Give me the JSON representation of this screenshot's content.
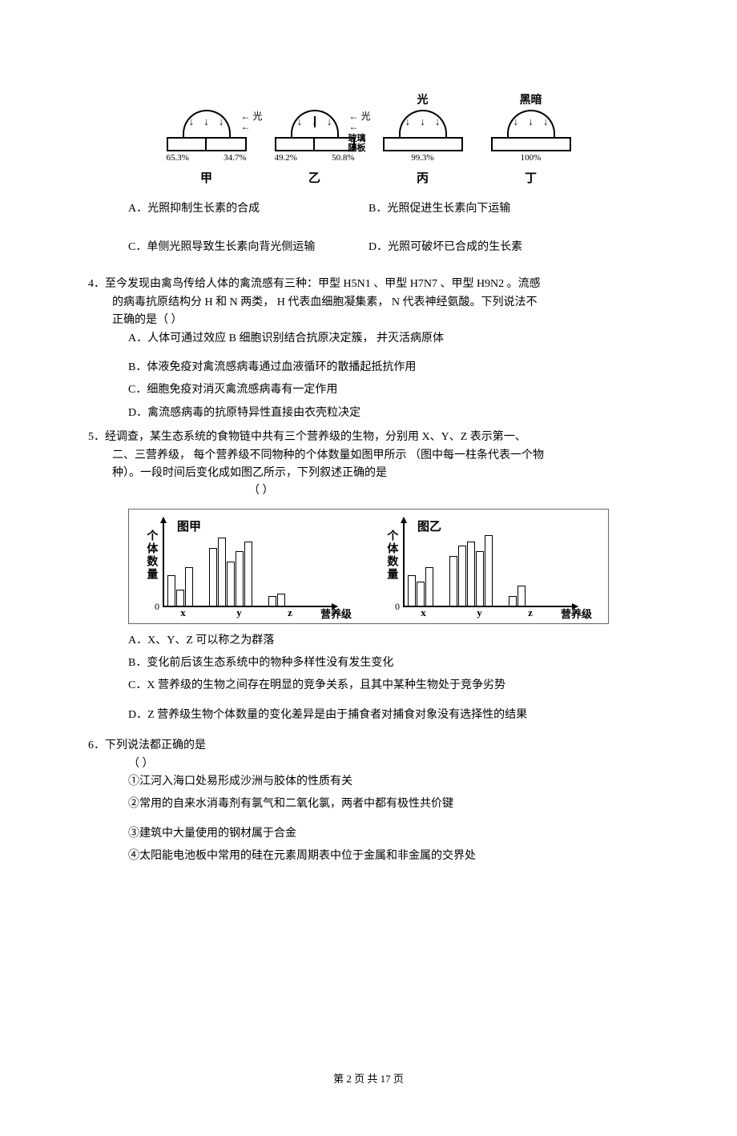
{
  "diagram_top": {
    "items": [
      {
        "top_label": "",
        "light_side": true,
        "glass": false,
        "left_pct": "65.3%",
        "right_pct": "34.7%",
        "name": "甲"
      },
      {
        "top_label": "",
        "light_side": true,
        "glass": true,
        "left_pct": "49.2%",
        "right_pct": "50.8%",
        "name": "乙"
      },
      {
        "top_label": "光",
        "light_side": false,
        "glass": false,
        "center_pct": "99.3%",
        "name": "丙"
      },
      {
        "top_label": "黑暗",
        "light_side": false,
        "glass": false,
        "center_pct": "100%",
        "name": "丁"
      }
    ],
    "light_label": "光",
    "glass_label_l1": "玻璃",
    "glass_label_l2": "隔板"
  },
  "q3_options": {
    "A": "A．光照抑制生长素的合成",
    "B": "B．光照促进生长素向下运输",
    "C": "C．单侧光照导致生长素向背光侧运输",
    "D": "D．光照可破坏已合成的生长素"
  },
  "q4": {
    "stem_l1": "4．至今发现由禽鸟传给人体的禽流感有三种：甲型    H5N1 、甲型 H7N7 、甲型 H9N2 。流感",
    "stem_l2": "的病毒抗原结构分   H 和 N 两类，  H 代表血细胞凝集素，   N 代表神经氨酸。下列说法不",
    "stem_l3": "正确的是（     ）",
    "A": "A．人体可通过效应   B 细胞识别结合抗原决定簇，   并灭活病原体",
    "B": "B．体液免疫对禽流感病毒通过血液循环的散播起抵抗作用",
    "C": "C．细胞免疫对消灭禽流感病毒有一定作用",
    "D": "D．禽流感病毒的抗原特异性直接由衣壳粒决定"
  },
  "q5": {
    "stem_l1": "5．经调查，某生态系统的食物链中共有三个营养级的生物，分别用        X、Y、Z 表示第一、",
    "stem_l2": "二、三营养级，  每个营养级不同物种的个体数量如图甲所示    （图中每一柱条代表一个物",
    "stem_l3": "种）。一段时间后变化成如图乙所示，下列叙述正确的是",
    "paren": "（     ）",
    "A": "A．X、Y、Z 可以称之为群落",
    "B": "B．变化前后该生态系统中的物种多样性没有发生变化",
    "C": "C．X 营养级的生物之间存在明显的竞争关系，且其中某种生物处于竞争劣势",
    "D": "D．Z 营养级生物个体数量的变化差异是由于捕食者对捕食对象没有选择性的结果"
  },
  "q6": {
    "stem": "6．下列说法都正确的是",
    "paren": "（     ）",
    "s1": "①江河入海口处易形成沙洲与胶体的性质有关",
    "s2": "②常用的自来水消毒剂有氯气和二氧化氯，两者中都有极性共价键",
    "s3": "③建筑中大量使用的钢材属于合金",
    "s4": "④太阳能电池板中常用的硅在元素周期表中位于金属和非金属的交界处"
  },
  "chart_data": [
    {
      "type": "bar",
      "title": "图甲",
      "ylabel": "个体数量",
      "xlabel": "营养级",
      "groups": [
        {
          "name": "x",
          "values": [
            38,
            20,
            48
          ]
        },
        {
          "name": "y",
          "values": [
            72,
            85,
            55,
            68,
            80
          ]
        },
        {
          "name": "z",
          "values": [
            12,
            15
          ]
        }
      ]
    },
    {
      "type": "bar",
      "title": "图乙",
      "ylabel": "个体数量",
      "xlabel": "营养级",
      "groups": [
        {
          "name": "x",
          "values": [
            38,
            30,
            48
          ]
        },
        {
          "name": "y",
          "values": [
            62,
            75,
            80,
            68,
            88
          ]
        },
        {
          "name": "z",
          "values": [
            12,
            25
          ]
        }
      ]
    }
  ],
  "footer": "第 2 页 共 17 页"
}
